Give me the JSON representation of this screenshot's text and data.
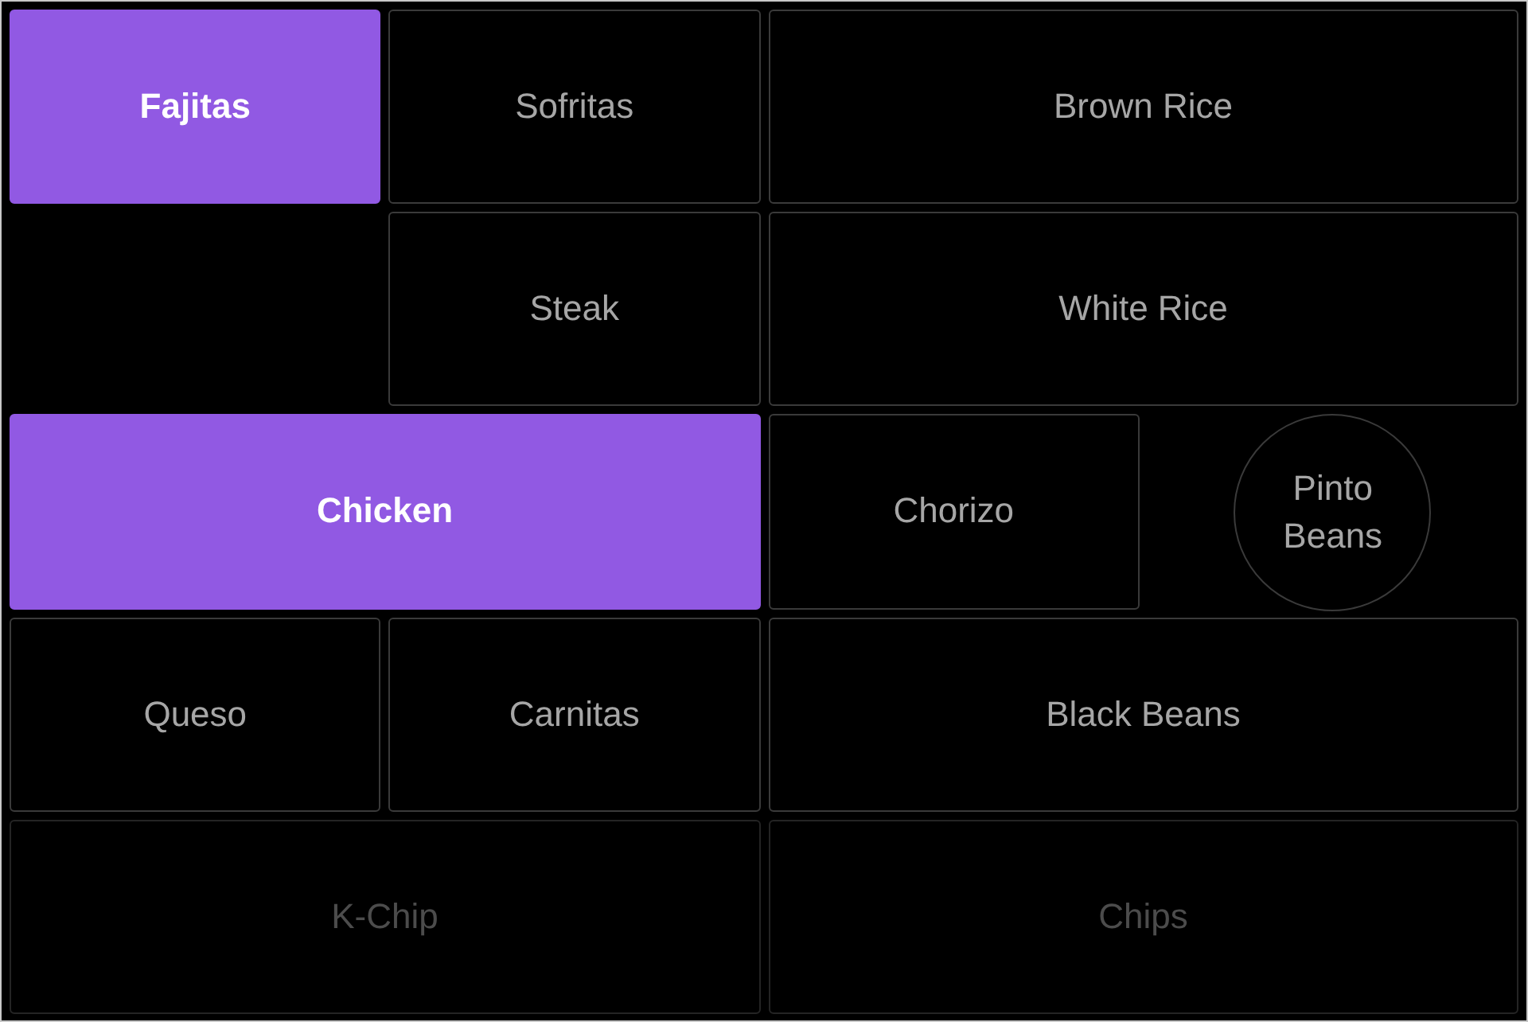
{
  "buttons": [
    {
      "label": "Fajitas",
      "kind": "tile",
      "selected": true,
      "disabled": false
    },
    {
      "label": "Sofritas",
      "kind": "tile",
      "selected": false,
      "disabled": false
    },
    {
      "label": "Brown Rice",
      "kind": "tile",
      "selected": false,
      "disabled": false
    },
    {
      "label": "Steak",
      "kind": "tile",
      "selected": false,
      "disabled": false
    },
    {
      "label": "White Rice",
      "kind": "tile",
      "selected": false,
      "disabled": false
    },
    {
      "label": "Chicken",
      "kind": "tile",
      "selected": true,
      "disabled": false
    },
    {
      "label": "Chorizo",
      "kind": "tile",
      "selected": false,
      "disabled": false
    },
    {
      "label": "Pinto Beans",
      "kind": "round",
      "selected": false,
      "disabled": false
    },
    {
      "label": "Queso",
      "kind": "tile",
      "selected": false,
      "disabled": false
    },
    {
      "label": "Carnitas",
      "kind": "tile",
      "selected": false,
      "disabled": false
    },
    {
      "label": "Black Beans",
      "kind": "tile",
      "selected": false,
      "disabled": false
    },
    {
      "label": "K-Chip",
      "kind": "tile",
      "selected": false,
      "disabled": true
    },
    {
      "label": "Chips",
      "kind": "tile",
      "selected": false,
      "disabled": true
    }
  ]
}
